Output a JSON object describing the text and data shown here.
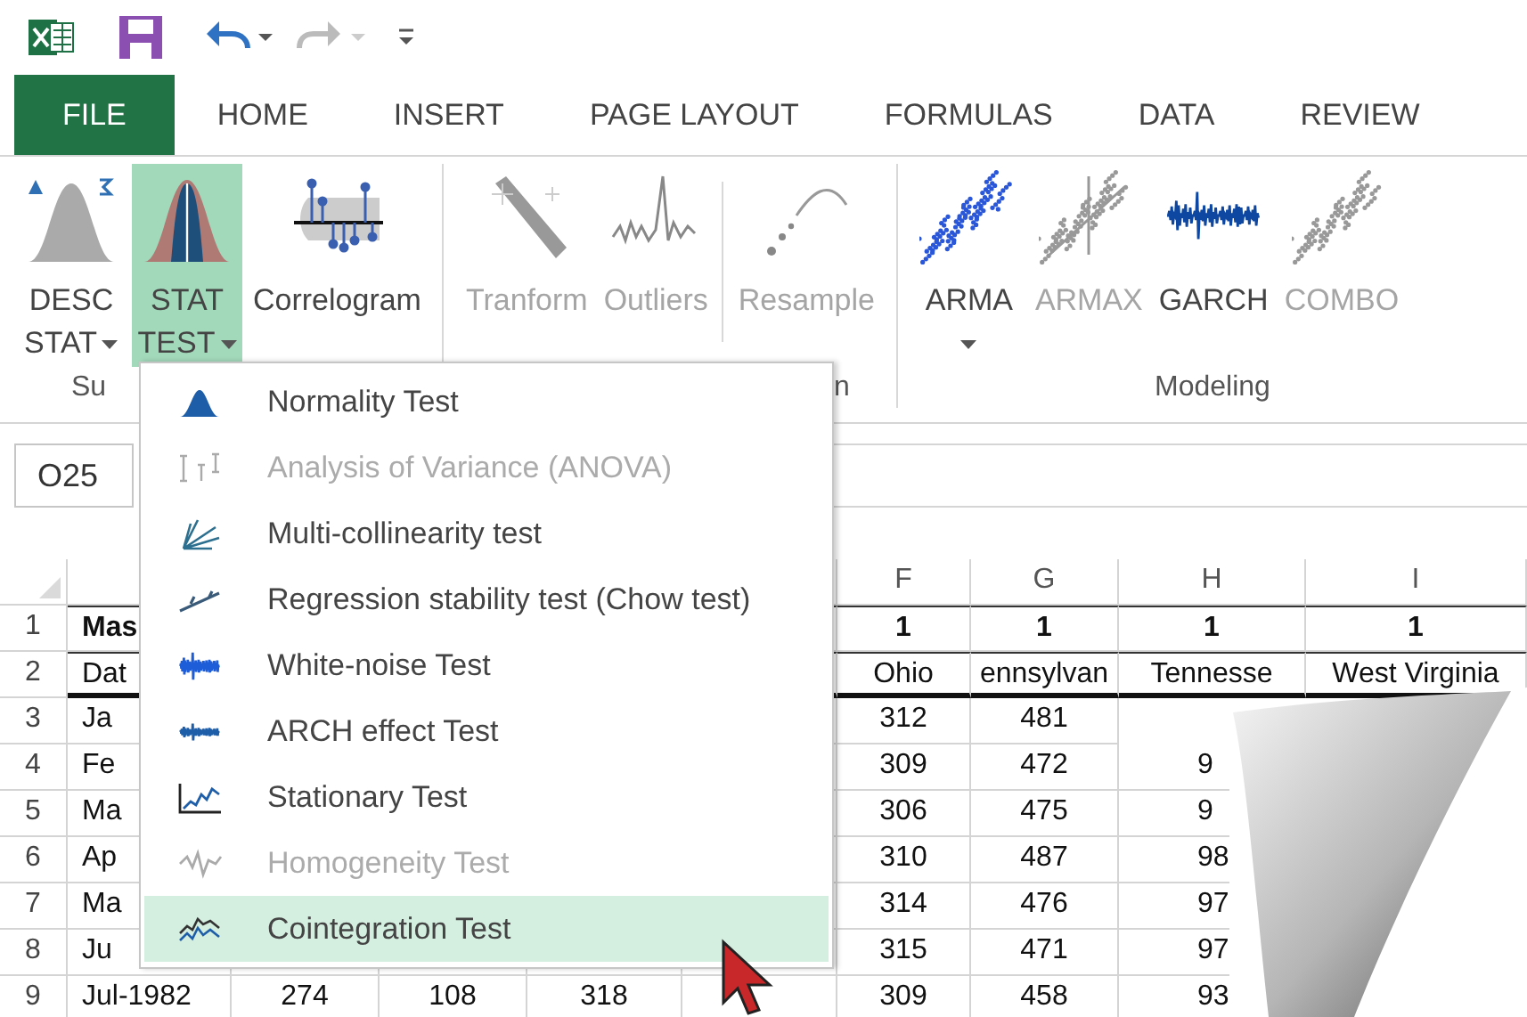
{
  "quick_access": {
    "undo": {
      "disabled": false
    },
    "redo": {
      "disabled": true
    }
  },
  "tabs": [
    {
      "label": "FILE",
      "kind": "file"
    },
    {
      "label": "HOME",
      "kind": "tab"
    },
    {
      "label": "INSERT",
      "kind": "tab"
    },
    {
      "label": "PAGE LAYOUT",
      "kind": "tab"
    },
    {
      "label": "FORMULAS",
      "kind": "tab"
    },
    {
      "label": "DATA",
      "kind": "tab"
    },
    {
      "label": "REVIEW",
      "kind": "tab"
    }
  ],
  "ribbon": {
    "groups": [
      {
        "label": "Su",
        "sections": [
          [
            {
              "lines": [
                "DESC",
                "STAT"
              ],
              "dropdown": true,
              "disabled": false,
              "selected": false
            },
            {
              "lines": [
                "STAT",
                "TEST"
              ],
              "dropdown": true,
              "disabled": false,
              "selected": true
            },
            {
              "lines": [
                "Correlogram"
              ],
              "dropdown": false,
              "disabled": false,
              "selected": false
            }
          ]
        ]
      },
      {
        "label": "n",
        "sections": [
          [
            {
              "lines": [
                "Tranform"
              ],
              "dropdown": false,
              "disabled": true,
              "selected": false
            },
            {
              "lines": [
                "Outliers"
              ],
              "dropdown": false,
              "disabled": true,
              "selected": false
            }
          ],
          [
            {
              "lines": [
                "Resample"
              ],
              "dropdown": false,
              "disabled": true,
              "selected": false
            }
          ]
        ]
      },
      {
        "label": "Modeling",
        "sections": [
          [
            {
              "lines": [
                "ARMA"
              ],
              "dropdown": true,
              "disabled": false,
              "selected": false
            },
            {
              "lines": [
                "ARMAX"
              ],
              "dropdown": false,
              "disabled": true,
              "selected": false
            },
            {
              "lines": [
                "GARCH"
              ],
              "dropdown": false,
              "disabled": false,
              "selected": false
            },
            {
              "lines": [
                "COMBO"
              ],
              "dropdown": false,
              "disabled": true,
              "selected": false
            }
          ]
        ]
      }
    ]
  },
  "name_box": {
    "value": "O25"
  },
  "grid": {
    "column_headers": [
      "F",
      "G",
      "H",
      "I"
    ],
    "rows": [
      {
        "number": "1",
        "bold": true,
        "cells": [
          "Mas",
          null,
          null,
          null,
          null,
          "1",
          "1",
          "1",
          "1"
        ]
      },
      {
        "number": "2",
        "bold": false,
        "cells": [
          "Dat",
          null,
          null,
          null,
          null,
          "Ohio",
          "ennsylvan",
          "Tennesse",
          "West Virginia"
        ]
      },
      {
        "number": "3",
        "bold": false,
        "cells": [
          "Ja",
          null,
          null,
          null,
          null,
          "312",
          "481",
          null,
          null
        ]
      },
      {
        "number": "4",
        "bold": false,
        "cells": [
          "Fe",
          null,
          null,
          null,
          null,
          "309",
          "472",
          "9",
          null
        ]
      },
      {
        "number": "5",
        "bold": false,
        "cells": [
          "Ma",
          null,
          null,
          null,
          null,
          "306",
          "475",
          "9",
          null
        ]
      },
      {
        "number": "6",
        "bold": false,
        "cells": [
          "Ap",
          null,
          null,
          null,
          null,
          "310",
          "487",
          "98",
          null
        ]
      },
      {
        "number": "7",
        "bold": false,
        "cells": [
          "Ma",
          null,
          null,
          null,
          null,
          "314",
          "476",
          "97",
          null
        ]
      },
      {
        "number": "8",
        "bold": false,
        "cells": [
          "Ju",
          null,
          null,
          null,
          null,
          "315",
          "471",
          "97",
          null
        ]
      },
      {
        "number": "9",
        "bold": false,
        "cells": [
          "Jul-1982",
          "274",
          "108",
          "318",
          null,
          "309",
          "458",
          "93",
          null
        ]
      }
    ]
  },
  "menu": {
    "items": [
      {
        "label": "Normality Test",
        "disabled": false,
        "selected": false
      },
      {
        "label": "Analysis of Variance (ANOVA)",
        "disabled": true,
        "selected": false
      },
      {
        "label": "Multi-collinearity test",
        "disabled": false,
        "selected": false
      },
      {
        "label": "Regression stability test (Chow test)",
        "disabled": false,
        "selected": false
      },
      {
        "label": "White-noise Test",
        "disabled": false,
        "selected": false
      },
      {
        "label": "ARCH effect Test",
        "disabled": false,
        "selected": false
      },
      {
        "label": "Stationary Test",
        "disabled": false,
        "selected": false
      },
      {
        "label": "Homogeneity Test",
        "disabled": true,
        "selected": false
      },
      {
        "label": "Cointegration Test",
        "disabled": false,
        "selected": true
      }
    ]
  }
}
